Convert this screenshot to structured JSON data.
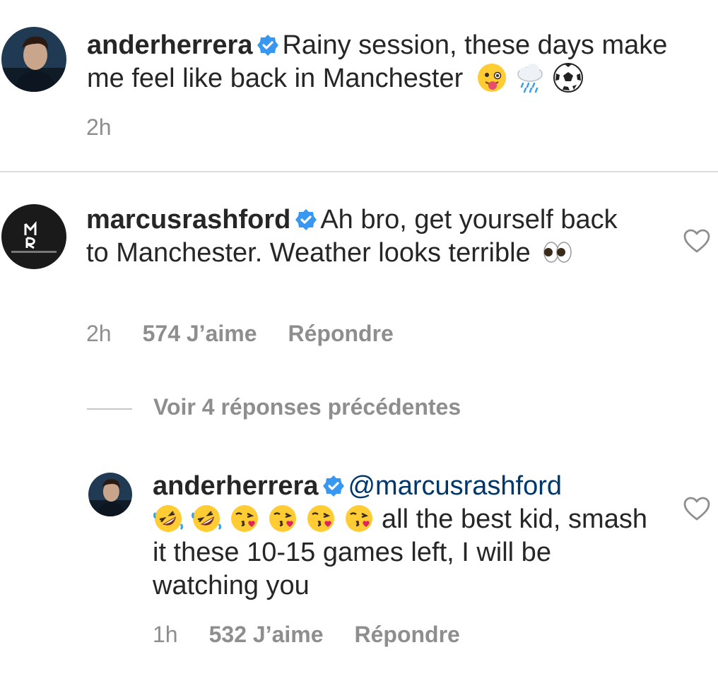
{
  "caption": {
    "username": "anderherrera",
    "text": "Rainy session, these days make me feel like back in Manchester",
    "emojis": [
      "winking-tongue-emoji",
      "rain-cloud-emoji",
      "soccer-ball-emoji"
    ],
    "time": "2h"
  },
  "comment": {
    "username": "marcusrashford",
    "text": "Ah bro, get yourself back to Manchester. Weather looks terrible",
    "emojis": [
      "eyes-emoji"
    ],
    "time": "2h",
    "likes": "574 J’aime",
    "reply_label": "Répondre",
    "avatar_brand": "MARCUS RASHFORD"
  },
  "view_replies": {
    "label": "Voir 4 réponses précédentes"
  },
  "reply": {
    "username": "anderherrera",
    "mention": "@marcusrashford",
    "emojis": [
      "rolling-laughing-emoji",
      "rolling-laughing-emoji",
      "kissing-heart-emoji",
      "kissing-heart-emoji",
      "kissing-heart-emoji",
      "kissing-heart-emoji"
    ],
    "text": "all the best kid, smash it these 10-15 games left, I will be watching you",
    "time": "1h",
    "likes": "532 J’aime",
    "reply_label": "Répondre"
  },
  "colors": {
    "text": "#262626",
    "secondary": "#8e8e8e",
    "verified": "#3897f0",
    "mention": "#00376b",
    "divider": "#dbdbdb"
  }
}
